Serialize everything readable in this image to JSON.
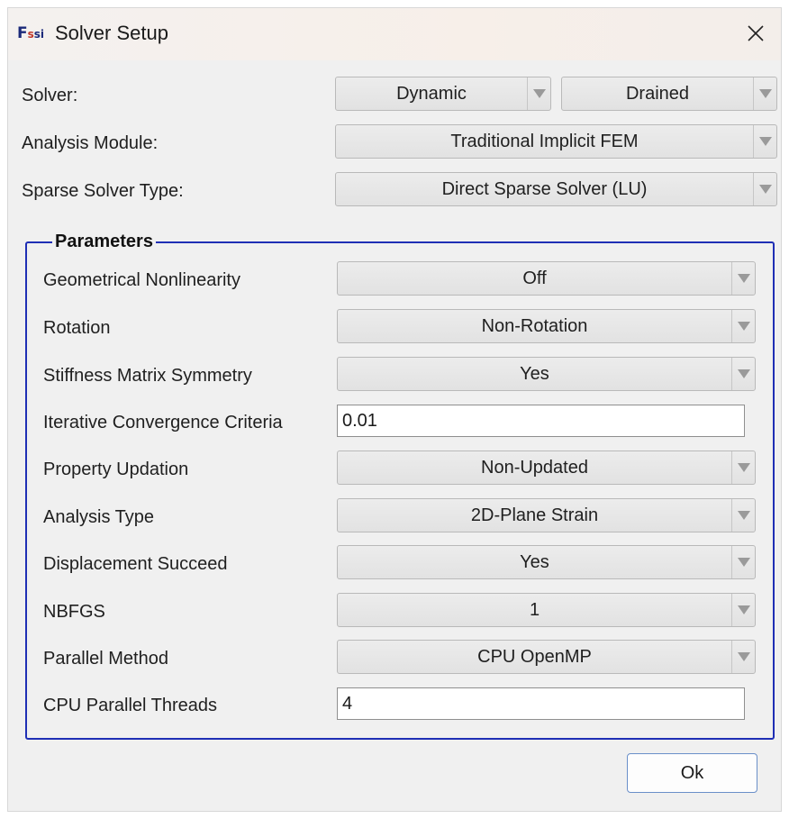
{
  "window": {
    "title": "Solver Setup",
    "icon_name": "fssi-app-icon",
    "close_icon": "close-icon"
  },
  "top_rows": {
    "solver": {
      "label": "Solver:",
      "value_1": "Dynamic",
      "value_2": "Drained"
    },
    "analysis_module": {
      "label": "Analysis Module:",
      "value": "Traditional Implicit FEM"
    },
    "sparse_solver_type": {
      "label": "Sparse Solver Type:",
      "value": "Direct Sparse Solver (LU)"
    }
  },
  "parameters": {
    "title": "Parameters",
    "rows": [
      {
        "label": "Geometrical Nonlinearity",
        "kind": "combo",
        "value": "Off"
      },
      {
        "label": "Rotation",
        "kind": "combo",
        "value": "Non-Rotation"
      },
      {
        "label": "Stiffness Matrix Symmetry",
        "kind": "combo",
        "value": "Yes"
      },
      {
        "label": "Iterative Convergence Criteria",
        "kind": "text",
        "value": "0.01"
      },
      {
        "label": "Property Updation",
        "kind": "combo",
        "value": "Non-Updated"
      },
      {
        "label": "Analysis Type",
        "kind": "combo",
        "value": "2D-Plane Strain"
      },
      {
        "label": "Displacement Succeed",
        "kind": "combo",
        "value": "Yes"
      },
      {
        "label": "NBFGS",
        "kind": "combo",
        "value": "1"
      },
      {
        "label": "Parallel Method",
        "kind": "combo",
        "value": "CPU OpenMP"
      },
      {
        "label": "CPU Parallel Threads",
        "kind": "text",
        "value": "4"
      }
    ]
  },
  "buttons": {
    "ok_label": "Ok"
  },
  "colors": {
    "group_border": "#1f2fb5",
    "ok_border": "#6a8fc9"
  }
}
